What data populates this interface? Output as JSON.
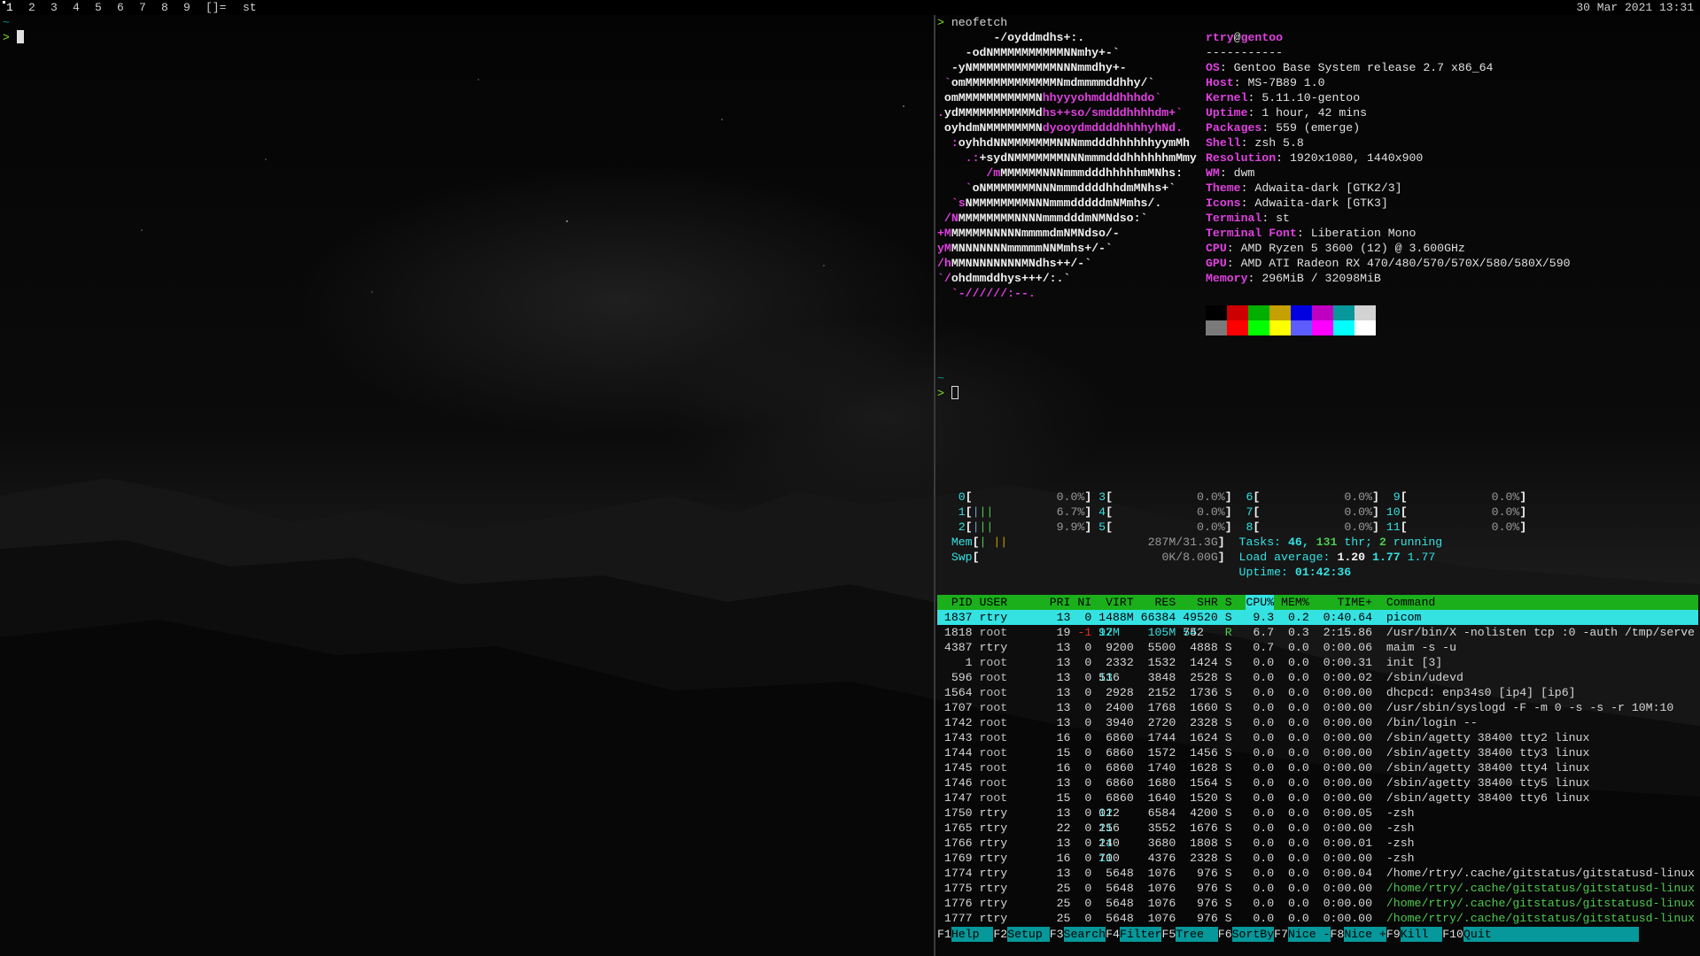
{
  "topbar": {
    "tags": [
      "1",
      "2",
      "3",
      "4",
      "5",
      "6",
      "7",
      "8",
      "9"
    ],
    "layout_symbol": "[]=",
    "window_title": "st",
    "clock": "30 Mar 2021 13:31"
  },
  "left_terminal": {
    "tilde": "~",
    "prompt": ">"
  },
  "right_terminal": {
    "prompt": ">",
    "command": "neofetch",
    "tilde": "~",
    "logo_lines": [
      [
        "        ",
        "-/oyddmdhs+:.",
        ""
      ],
      [
        "    ",
        "-odNMMMMMMMMMMNNmhy+-`",
        ""
      ],
      [
        "  ",
        "-yNMMMMMMMMMMMMNNNmmdhy+-",
        ""
      ],
      [
        " `",
        "omMMMMMMMMMMMMMNmdmmmmddhhy/`",
        ""
      ],
      [
        " ",
        "omMMMMMMMMMMMN",
        "hhyyyohmdddhhhdo`"
      ],
      [
        ".",
        "ydMMMMMMMMMMMd",
        "hs++so/smdddhhhhdm+`"
      ],
      [
        " ",
        "oyhdmNMMMMMMMN",
        "dyooydmddddhhhhyhNd."
      ],
      [
        "  :",
        "oyhhdNNMMMMMMMNNNmmdddhhhhhhyymMh",
        ""
      ],
      [
        "    .:",
        "+sydNMMMMMMMNNNmmmdddhhhhhhmMmy",
        ""
      ],
      [
        "       /m",
        "MMMMMMNNNmmmdddhhhhhmMNhs:",
        ""
      ],
      [
        "    `",
        "oNMMMMMMMNNNmmmddddhhdmMNhs+`",
        ""
      ],
      [
        "  `s",
        "NMMMMMMMMNNNmmmdddddmNMmhs/.",
        ""
      ],
      [
        " /N",
        "MMMMMMMMNNNNmmmdddmNMNdso:`",
        ""
      ],
      [
        "+M",
        "MMMMMNNNNNmmmmdmNMNdso/-",
        ""
      ],
      [
        "yM",
        "MNNNNNNNmmmmmNNMmhs+/-`",
        ""
      ],
      [
        "/h",
        "MMNNNNNNNNMNdhs++/-`",
        ""
      ],
      [
        "`/",
        "ohdmmddhys+++/:.`",
        ""
      ],
      [
        "  `-//////:--.",
        "",
        ""
      ]
    ],
    "info": {
      "user": "rtry",
      "host": "gentoo",
      "separator": "-----------",
      "rows": [
        {
          "key": "OS",
          "value": "Gentoo Base System release 2.7 x86_64"
        },
        {
          "key": "Host",
          "value": "MS-7B89 1.0"
        },
        {
          "key": "Kernel",
          "value": "5.11.10-gentoo"
        },
        {
          "key": "Uptime",
          "value": "1 hour, 42 mins"
        },
        {
          "key": "Packages",
          "value": "559 (emerge)"
        },
        {
          "key": "Shell",
          "value": "zsh 5.8"
        },
        {
          "key": "Resolution",
          "value": "1920x1080, 1440x900"
        },
        {
          "key": "WM",
          "value": "dwm"
        },
        {
          "key": "Theme",
          "value": "Adwaita-dark [GTK2/3]"
        },
        {
          "key": "Icons",
          "value": "Adwaita-dark [GTK3]"
        },
        {
          "key": "Terminal",
          "value": "st"
        },
        {
          "key": "Terminal Font",
          "value": "Liberation Mono"
        },
        {
          "key": "CPU",
          "value": "AMD Ryzen 5 3600 (12) @ 3.600GHz"
        },
        {
          "key": "GPU",
          "value": "AMD ATI Radeon RX 470/480/570/570X/580/580X/590"
        },
        {
          "key": "Memory",
          "value": "296MiB / 32098MiB"
        }
      ]
    },
    "palette_top": [
      "#000000",
      "#cc0000",
      "#00b000",
      "#c4a000",
      "#0000e0",
      "#c000c0",
      "#06989a",
      "#d3d3d3"
    ],
    "palette_bottom": [
      "#7a7a7a",
      "#ff0000",
      "#00ff00",
      "#ffff00",
      "#5c5cff",
      "#ff00ff",
      "#00ffff",
      "#ffffff"
    ]
  },
  "htop": {
    "cpus": [
      {
        "id": "0",
        "bars": "",
        "pct": "0.0%"
      },
      {
        "id": "1",
        "bars": "|||",
        "pct": "6.7%"
      },
      {
        "id": "2",
        "bars": "|||",
        "pct": "9.9%"
      },
      {
        "id": "3",
        "bars": "",
        "pct": "0.0%"
      },
      {
        "id": "4",
        "bars": "",
        "pct": "0.0%"
      },
      {
        "id": "5",
        "bars": "",
        "pct": "0.0%"
      },
      {
        "id": "6",
        "bars": "",
        "pct": "0.0%"
      },
      {
        "id": "7",
        "bars": "",
        "pct": "0.0%"
      },
      {
        "id": "8",
        "bars": "",
        "pct": "0.0%"
      },
      {
        "id": "9",
        "bars": "",
        "pct": "0.0%"
      },
      {
        "id": "10",
        "bars": "",
        "pct": "0.0%"
      },
      {
        "id": "11",
        "bars": "",
        "pct": "0.0%"
      }
    ],
    "mem_label": "Mem",
    "mem_value": "287M/31.3G",
    "swp_label": "Swp",
    "swp_value": "0K/8.00G",
    "tasks_label": "Tasks:",
    "tasks": "46",
    "thr": "131",
    "thr_label": "thr;",
    "running": "2",
    "running_label": "running",
    "load_label": "Load average:",
    "load1": "1.20",
    "load5": "1.77",
    "load15": "1.77",
    "uptime_label": "Uptime:",
    "uptime": "01:42:36",
    "columns": [
      "PID",
      "USER",
      "PRI",
      "NI",
      "VIRT",
      "RES",
      "SHR",
      "S",
      "CPU%",
      "MEM%",
      "TIME+",
      "Command"
    ],
    "processes": [
      [
        "1837",
        "rtry",
        "13",
        "0",
        "1488M",
        "66384",
        "49520",
        "S",
        "9.3",
        "0.2",
        "0:40.64",
        "picom"
      ],
      [
        "1818",
        "root",
        "19",
        "-1",
        "1297M",
        "105M",
        "54752",
        "R",
        "6.7",
        "0.3",
        "2:15.86",
        "/usr/bin/X -nolisten tcp :0 -auth /tmp/serve"
      ],
      [
        "4387",
        "rtry",
        "13",
        "0",
        "9200",
        "5500",
        "4888",
        "S",
        "0.7",
        "0.0",
        "0:00.06",
        "maim -s -u"
      ],
      [
        "1",
        "root",
        "13",
        "0",
        "2332",
        "1532",
        "1424",
        "S",
        "0.0",
        "0.0",
        "0:00.31",
        "init [3]"
      ],
      [
        "596",
        "root",
        "13",
        "0",
        "13516",
        "3848",
        "2528",
        "S",
        "0.0",
        "0.0",
        "0:00.02",
        "/sbin/udevd"
      ],
      [
        "1564",
        "root",
        "13",
        "0",
        "2928",
        "2152",
        "1736",
        "S",
        "0.0",
        "0.0",
        "0:00.00",
        "dhcpcd: enp34s0 [ip4] [ip6]"
      ],
      [
        "1707",
        "root",
        "13",
        "0",
        "2400",
        "1768",
        "1660",
        "S",
        "0.0",
        "0.0",
        "0:00.00",
        "/usr/sbin/syslogd -F -m 0 -s -s -r 10M:10"
      ],
      [
        "1742",
        "root",
        "13",
        "0",
        "3940",
        "2720",
        "2328",
        "S",
        "0.0",
        "0.0",
        "0:00.00",
        "/bin/login --"
      ],
      [
        "1743",
        "root",
        "16",
        "0",
        "6860",
        "1744",
        "1624",
        "S",
        "0.0",
        "0.0",
        "0:00.00",
        "/sbin/agetty 38400 tty2 linux"
      ],
      [
        "1744",
        "root",
        "15",
        "0",
        "6860",
        "1572",
        "1456",
        "S",
        "0.0",
        "0.0",
        "0:00.00",
        "/sbin/agetty 38400 tty3 linux"
      ],
      [
        "1745",
        "root",
        "16",
        "0",
        "6860",
        "1740",
        "1628",
        "S",
        "0.0",
        "0.0",
        "0:00.00",
        "/sbin/agetty 38400 tty4 linux"
      ],
      [
        "1746",
        "root",
        "13",
        "0",
        "6860",
        "1680",
        "1564",
        "S",
        "0.0",
        "0.0",
        "0:00.00",
        "/sbin/agetty 38400 tty5 linux"
      ],
      [
        "1747",
        "root",
        "15",
        "0",
        "6860",
        "1640",
        "1520",
        "S",
        "0.0",
        "0.0",
        "0:00.00",
        "/sbin/agetty 38400 tty6 linux"
      ],
      [
        "1750",
        "rtry",
        "13",
        "0",
        "12012",
        "6584",
        "4200",
        "S",
        "0.0",
        "0.0",
        "0:00.05",
        "-zsh"
      ],
      [
        "1765",
        "rtry",
        "22",
        "0",
        "11256",
        "3552",
        "1676",
        "S",
        "0.0",
        "0.0",
        "0:00.00",
        "-zsh"
      ],
      [
        "1766",
        "rtry",
        "13",
        "0",
        "11240",
        "3680",
        "1808",
        "S",
        "0.0",
        "0.0",
        "0:00.01",
        "-zsh"
      ],
      [
        "1769",
        "rtry",
        "16",
        "0",
        "11700",
        "4376",
        "2328",
        "S",
        "0.0",
        "0.0",
        "0:00.00",
        "-zsh"
      ],
      [
        "1774",
        "rtry",
        "13",
        "0",
        "5648",
        "1076",
        "976",
        "S",
        "0.0",
        "0.0",
        "0:00.04",
        "/home/rtry/.cache/gitstatus/gitstatusd-linux"
      ],
      [
        "1775",
        "rtry",
        "25",
        "0",
        "5648",
        "1076",
        "976",
        "S",
        "0.0",
        "0.0",
        "0:00.00",
        "/home/rtry/.cache/gitstatus/gitstatusd-linux"
      ],
      [
        "1776",
        "rtry",
        "25",
        "0",
        "5648",
        "1076",
        "976",
        "S",
        "0.0",
        "0.0",
        "0:00.00",
        "/home/rtry/.cache/gitstatus/gitstatusd-linux"
      ],
      [
        "1777",
        "rtry",
        "25",
        "0",
        "5648",
        "1076",
        "976",
        "S",
        "0.0",
        "0.0",
        "0:00.00",
        "/home/rtry/.cache/gitstatus/gitstatusd-linux"
      ]
    ],
    "green_command_rows": [
      18,
      19,
      20
    ],
    "fkeys": [
      {
        "key": "F1",
        "label": "Help"
      },
      {
        "key": "F2",
        "label": "Setup"
      },
      {
        "key": "F3",
        "label": "Search"
      },
      {
        "key": "F4",
        "label": "Filter"
      },
      {
        "key": "F5",
        "label": "Tree"
      },
      {
        "key": "F6",
        "label": "SortBy"
      },
      {
        "key": "F7",
        "label": "Nice -"
      },
      {
        "key": "F8",
        "label": "Nice +"
      },
      {
        "key": "F9",
        "label": "Kill"
      },
      {
        "key": "F10",
        "label": "Quit"
      }
    ]
  }
}
